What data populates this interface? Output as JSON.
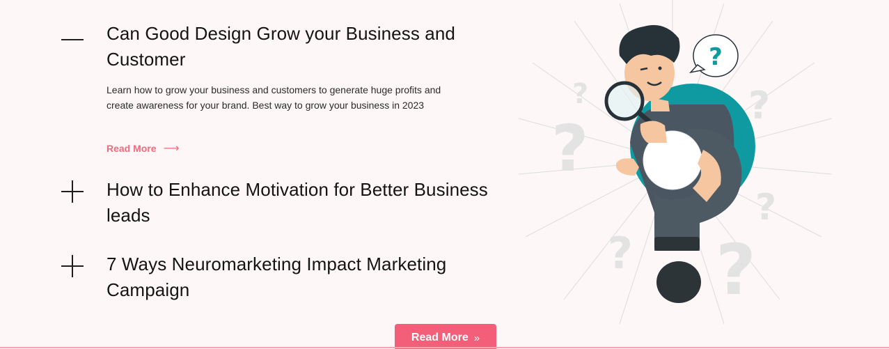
{
  "faq": {
    "items": [
      {
        "title": "Can Good Design Grow your Business and Customer",
        "description": "Learn how to grow your business and customers to generate huge profits and create awareness for your brand. Best way to grow your business in 2023",
        "link_label": "Read More",
        "link_icon": "arrow-right-icon",
        "state": "expanded",
        "toggle_icon": "minus-icon"
      },
      {
        "title": "How to Enhance Motivation for Better Business leads",
        "state": "collapsed",
        "toggle_icon": "plus-icon"
      },
      {
        "title": "7 Ways Neuromarketing Impact Marketing Campaign",
        "state": "collapsed",
        "toggle_icon": "plus-icon"
      }
    ]
  },
  "cta": {
    "label": "Read More",
    "icon": "double-chevron-right-icon"
  },
  "illustration": {
    "bubble_text": "?",
    "subject": "person-with-magnifier-and-question-mark"
  },
  "colors": {
    "accent": "#f35f79",
    "link": "#f06a7d",
    "teal": "#0e9aa0",
    "background": "#fdf8f7"
  }
}
